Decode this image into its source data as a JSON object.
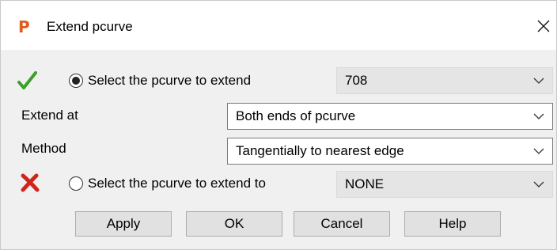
{
  "window": {
    "title": "Extend pcurve",
    "app_icon_letter": "P",
    "app_icon_color": "#e05b1c",
    "close_glyph": "✕"
  },
  "rows": {
    "select_pcurve": {
      "status_icon": "check-icon",
      "status_color": "#3aa12a",
      "radio_checked": true,
      "label": "Select the pcurve to extend",
      "value": "708"
    },
    "extend_at": {
      "label": "Extend at",
      "value": "Both ends of pcurve"
    },
    "method": {
      "label": "Method",
      "value": "Tangentially to nearest edge"
    },
    "select_extend_to": {
      "status_icon": "x-icon",
      "status_color": "#d2231a",
      "radio_checked": false,
      "label": "Select the pcurve to extend to",
      "value": "NONE"
    }
  },
  "buttons": {
    "apply": "Apply",
    "ok": "OK",
    "cancel": "Cancel",
    "help": "Help"
  }
}
